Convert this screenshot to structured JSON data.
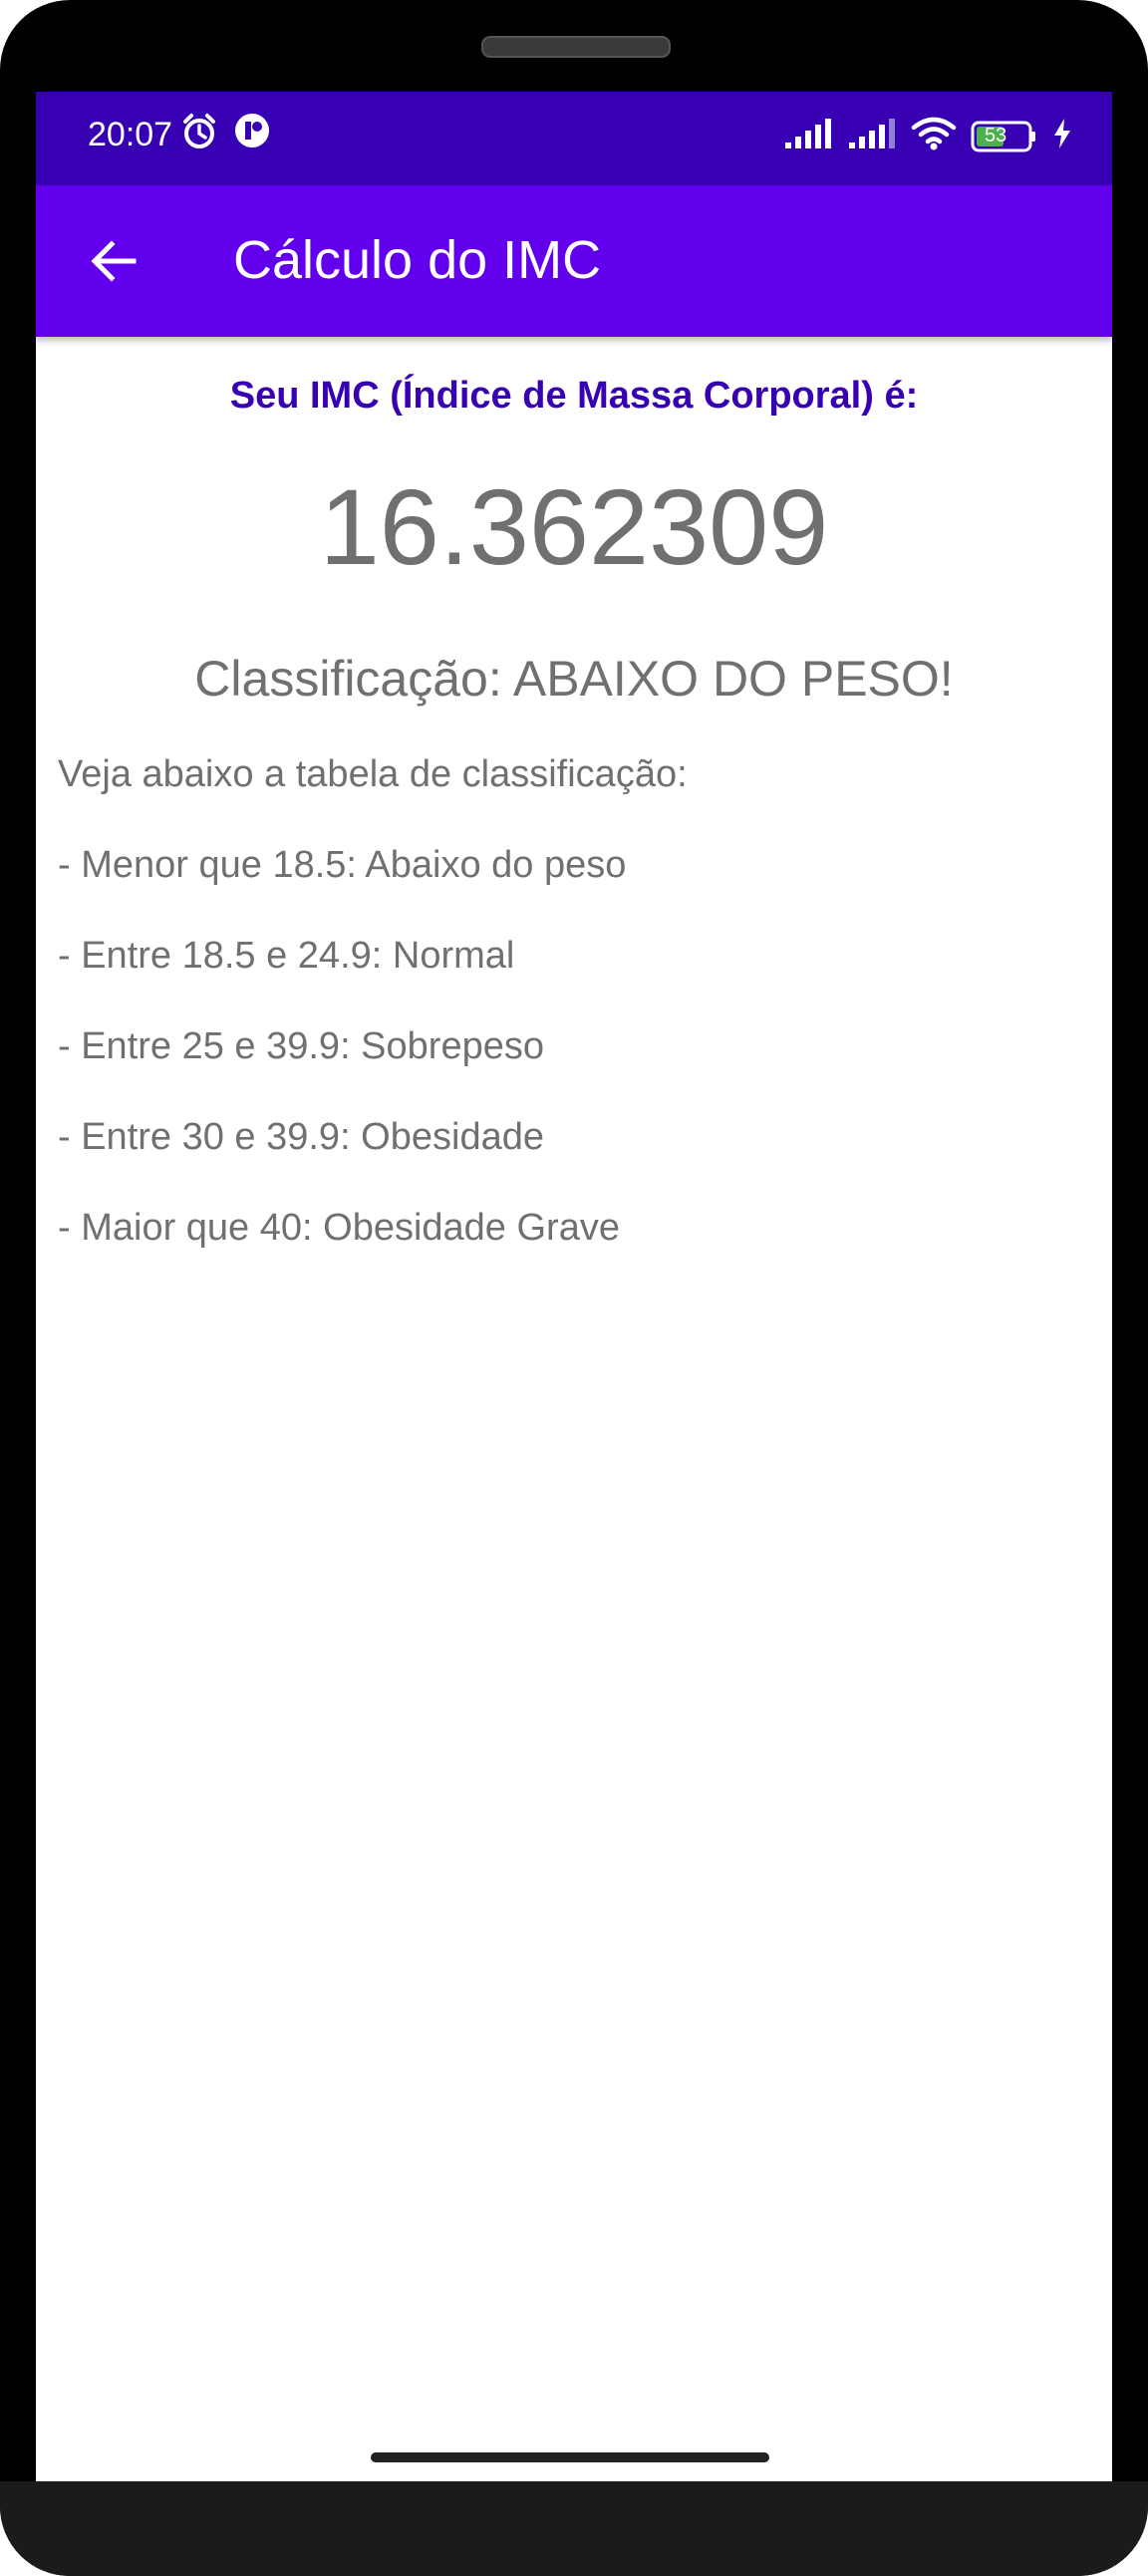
{
  "status_bar": {
    "time": "20:07",
    "battery": "53",
    "background_color": "#3700b3"
  },
  "app_bar": {
    "title": "Cálculo do IMC",
    "back_icon": "arrow-left-icon",
    "background_color": "#6200ee"
  },
  "result": {
    "heading": "Seu IMC (Índice de Massa Corporal) é:",
    "value": "16.362309",
    "classification": "Classificação: ABAIXO DO PESO!"
  },
  "table": {
    "intro": "Veja abaixo a tabela de classificação:",
    "items": [
      "- Menor que 18.5: Abaixo do peso",
      "- Entre 18.5 e 24.9: Normal",
      "- Entre 25 e 39.9: Sobrepeso",
      "- Entre 30 e 39.9: Obesidade",
      "- Maior que 40: Obesidade Grave"
    ]
  }
}
